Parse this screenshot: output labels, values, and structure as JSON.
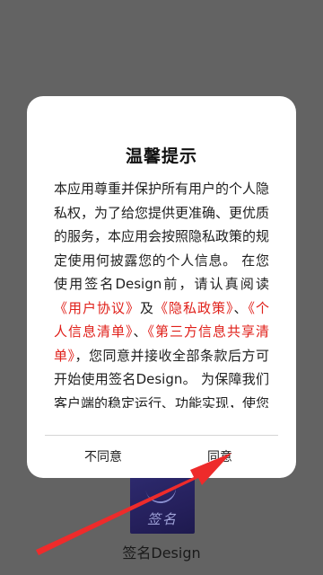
{
  "app": {
    "name": "签名Design",
    "icon_text": "签名",
    "icon_name": "signature-app-icon"
  },
  "dialog": {
    "title": "温馨提示",
    "body": {
      "p1": "本应用尊重并保护所有用户的个人隐私权，为了给您提供更准确、更优质的服务，本应用会按照隐私政策的规定使用何披露您的个人信息。 在您使用签名Design前，请认真阅读",
      "link_user_agreement": "《用户协议》",
      "sep1": "及",
      "link_privacy_policy": "《隐私政策》",
      "sep2": "、",
      "link_personal_info": "《个人信息清单》",
      "sep3": "、",
      "link_third_party": "《第三方信息共享清单》",
      "p2": "，您同意并接收全部条款后方可开始使用签名Design。 为保障我们客户端的稳定运行、功能实现，使您能够使用和享受更多"
    },
    "buttons": {
      "disagree": "不同意",
      "agree": "同意"
    }
  },
  "colors": {
    "overlay": "#636363",
    "link": "#e0201a",
    "annotation_arrow": "#ee2b2b"
  },
  "annotation": {
    "icon_name": "red-arrow-annotation-icon"
  }
}
